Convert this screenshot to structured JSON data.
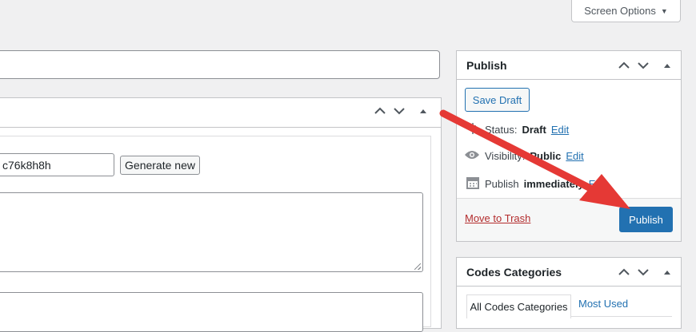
{
  "screen_options": {
    "label": "Screen Options",
    "caret": "▼"
  },
  "main_box": {
    "code_value": "c76k8h8h",
    "generate_label": "Generate new"
  },
  "publish": {
    "title": "Publish",
    "save_draft": "Save Draft",
    "status_label": "Status:",
    "status_value": "Draft",
    "visibility_label": "Visibility:",
    "visibility_value": "Public",
    "publish_label": "Publish",
    "publish_value": "immediately",
    "edit_link": "Edit",
    "move_to_trash": "Move to Trash",
    "publish_button": "Publish"
  },
  "categories": {
    "title": "Codes Categories",
    "tabs": [
      "All Codes Categories",
      "Most Used"
    ]
  },
  "colors": {
    "accent": "#2271b1",
    "trash": "#b32d2e",
    "annotation_arrow": "#e53935"
  },
  "icons": [
    "chevron-up-icon",
    "chevron-down-icon",
    "triangle-up-icon",
    "pin-icon",
    "eye-icon",
    "calendar-icon",
    "red-arrow-annotation"
  ]
}
